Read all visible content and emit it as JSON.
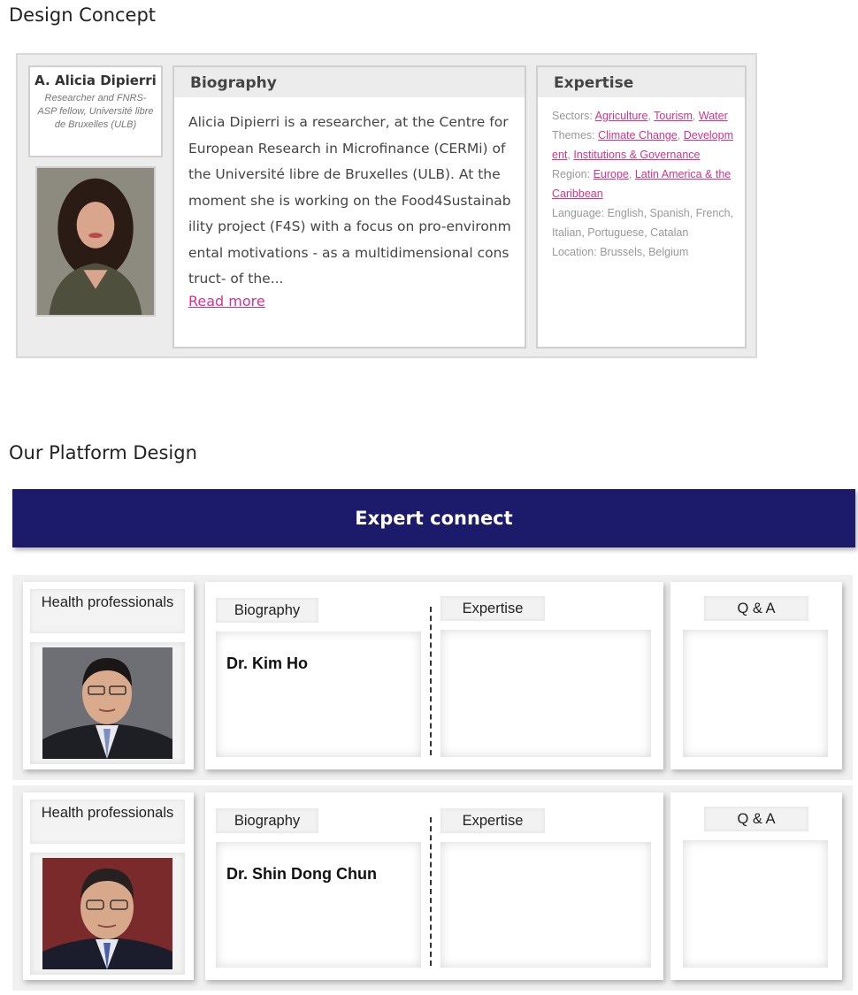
{
  "headings": {
    "design_concept": "Design Concept",
    "platform_design": "Our Platform Design"
  },
  "concept": {
    "name": "A. Alicia Dipierri",
    "role": "Researcher and FNRS-ASP fellow, Université libre de Bruxelles (ULB)",
    "biography_title": "Biography",
    "biography_text": "Alicia Dipierri is a researcher, at the Centre for European Research in Microfinance (CERMi) of the Université libre de Bruxelles (ULB). At the moment she is working on the Food4Sustainability project (F4S) with a focus on pro-environmental motivations - as a multidimensional construct- of the...",
    "read_more": "Read more",
    "expertise_title": "Expertise",
    "expertise": {
      "sectors_label": "Sectors:",
      "sectors": [
        "Agriculture",
        "Tourism",
        "Water"
      ],
      "themes_label": "Themes:",
      "themes": [
        "Climate Change",
        "Development",
        "Institutions & Governance"
      ],
      "region_label": "Region:",
      "regions": [
        "Europe",
        "Latin America & the Caribbean"
      ],
      "language_label": "Language:",
      "languages": "English, Spanish, French, Italian, Portuguese, Catalan",
      "location_label": "Location:",
      "location": "Brussels, Belgium"
    }
  },
  "platform": {
    "banner_title": "Expert connect",
    "rows": [
      {
        "category": "Health professionals",
        "biography_label": "Biography",
        "expertise_label": "Expertise",
        "qa_label": "Q & A",
        "doctor_name": "Dr. Kim Ho"
      },
      {
        "category": "Health professionals",
        "biography_label": "Biography",
        "expertise_label": "Expertise",
        "qa_label": "Q & A",
        "doctor_name": "Dr. Shin Dong Chun"
      }
    ]
  }
}
